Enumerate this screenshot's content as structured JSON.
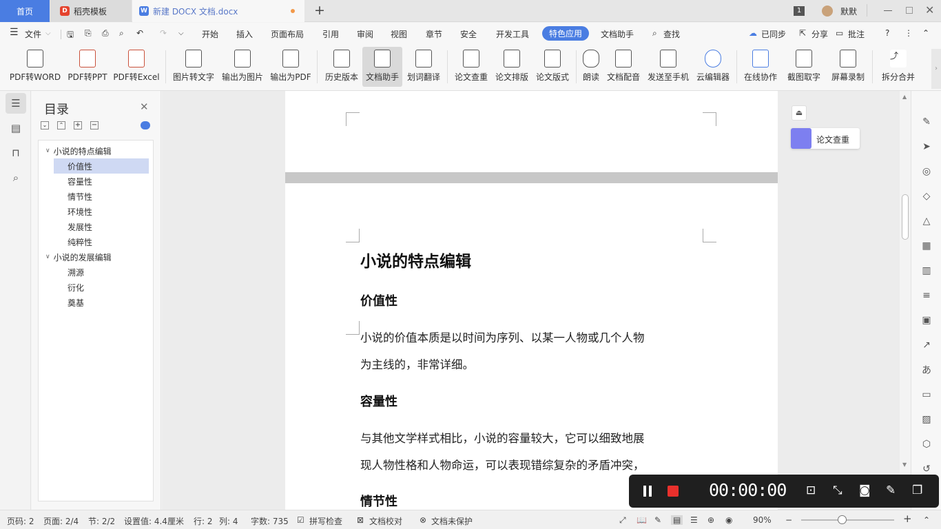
{
  "tabs": {
    "home": "首页",
    "templates": "稻壳模板",
    "document": "新建 DOCX 文档.docx",
    "new_tab": "+"
  },
  "titlebar": {
    "badge": "1",
    "user": "默默"
  },
  "menu": {
    "file": "文件",
    "items": [
      "开始",
      "插入",
      "页面布局",
      "引用",
      "审阅",
      "视图",
      "章节",
      "安全",
      "开发工具",
      "特色应用",
      "文档助手"
    ],
    "active": "特色应用",
    "search": "查找",
    "synced": "已同步",
    "share": "分享",
    "comment": "批注"
  },
  "ribbon": {
    "buttons": [
      "PDF转WORD",
      "PDF转PPT",
      "PDF转Excel",
      "图片转文字",
      "输出为图片",
      "输出为PDF",
      "历史版本",
      "文档助手",
      "划词翻译",
      "论文查重",
      "论文排版",
      "论文版式",
      "朗读",
      "文档配音",
      "发送至手机",
      "云编辑器",
      "在线协作",
      "截图取字",
      "屏幕录制",
      "拆分合并"
    ],
    "selected": "文档助手"
  },
  "toc": {
    "title": "目录",
    "items": [
      {
        "label": "小说的特点编辑",
        "level": 1
      },
      {
        "label": "价值性",
        "level": 2
      },
      {
        "label": "容量性",
        "level": 2
      },
      {
        "label": "情节性",
        "level": 2
      },
      {
        "label": "环境性",
        "level": 2
      },
      {
        "label": "发展性",
        "level": 2
      },
      {
        "label": "纯粹性",
        "level": 2
      },
      {
        "label": "小说的发展编辑",
        "level": 1
      },
      {
        "label": "溯源",
        "level": 2
      },
      {
        "label": "衍化",
        "level": 2
      },
      {
        "label": "奠基",
        "level": 2
      }
    ],
    "selected": "价值性"
  },
  "document": {
    "heading": "小说的特点编辑",
    "sec1_title": "价值性",
    "sec1_line1": "小说的价值本质是以时间为序列、以某一人物或几个人物",
    "sec1_line2": "为主线的，非常详细。",
    "sec2_title": "容量性",
    "sec2_line1": "与其他文学样式相比，小说的容量较大，它可以细致地展",
    "sec2_line2": "现人物性格和人物命运，可以表现错综复杂的矛盾冲突，",
    "sec3_title": "情节性"
  },
  "floating_panel": {
    "label": "论文查重"
  },
  "recorder": {
    "time": "00:00:00"
  },
  "status": {
    "page_num": "页码: 2",
    "page": "页面: 2/4",
    "section": "节: 2/2",
    "position": "设置值: 4.4厘米",
    "row": "行: 2",
    "col": "列: 4",
    "words": "字数: 735",
    "spell": "拼写检查",
    "proof": "文档校对",
    "protect": "文档未保护",
    "zoom": "90%"
  },
  "colors": {
    "accent": "#4a7de2",
    "recorder_bg": "#1f1f1f",
    "record_red": "#e8302c"
  }
}
